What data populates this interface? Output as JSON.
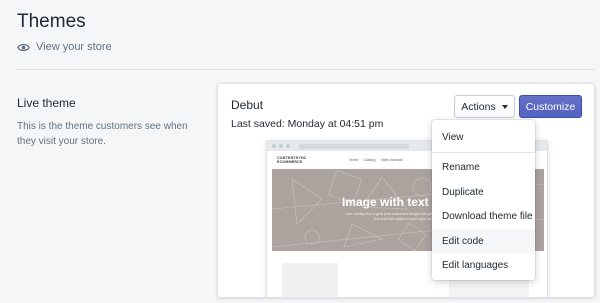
{
  "page": {
    "title": "Themes",
    "view_store": "View your store"
  },
  "live_theme": {
    "title": "Live theme",
    "description": "This is the theme customers see when they visit your store."
  },
  "theme_card": {
    "name": "Debut",
    "last_saved": "Last saved: Monday at 04:51 pm",
    "actions_label": "Actions",
    "customize_label": "Customize"
  },
  "preview": {
    "store_logo": "CONTENTSYNC ECOMMERCE",
    "nav": [
      "Home",
      "Catalog",
      "Video tutorials"
    ],
    "hero_title": "Image with text overlay",
    "hero_subtitle": "Use overlay text to give your customers insight into your brand. Select imagery and text that relates to your style and story."
  },
  "dropdown": {
    "items": [
      "View",
      "Rename",
      "Duplicate",
      "Download theme file",
      "Edit code",
      "Edit languages"
    ],
    "highlighted": "Edit code"
  },
  "colors": {
    "background": "#f4f6f8",
    "primary": "#5c6ac4",
    "text": "#212b36",
    "subdued": "#637381",
    "hero": "#aca39f"
  }
}
